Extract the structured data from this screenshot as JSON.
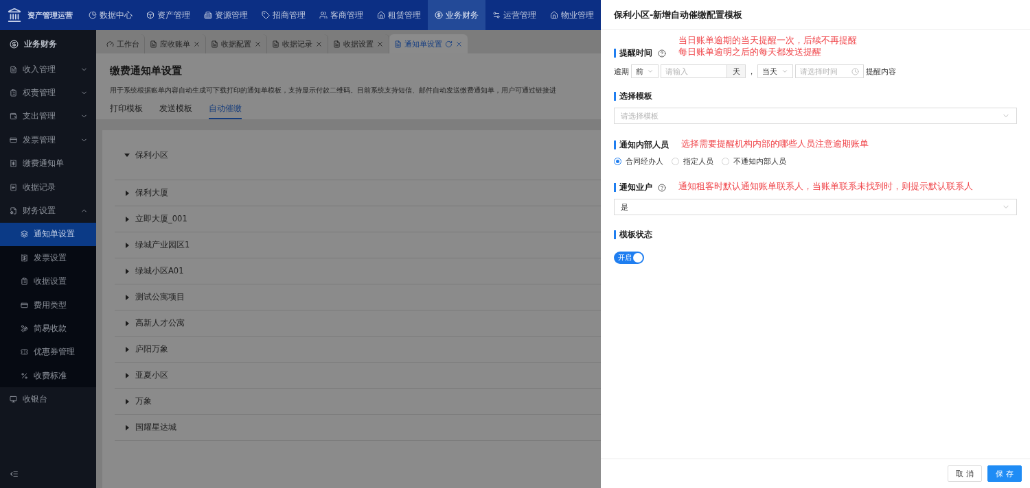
{
  "app": {
    "title": "资产管理运营"
  },
  "top_nav": [
    {
      "label": "数据中心",
      "selected": false
    },
    {
      "label": "资产管理",
      "selected": false
    },
    {
      "label": "资源管理",
      "selected": false
    },
    {
      "label": "招商管理",
      "selected": false
    },
    {
      "label": "客商管理",
      "selected": false
    },
    {
      "label": "租赁管理",
      "selected": false
    },
    {
      "label": "业务财务",
      "selected": true
    },
    {
      "label": "运营管理",
      "selected": false
    },
    {
      "label": "物业管理",
      "selected": false
    }
  ],
  "sidebar": {
    "header": "业务财务",
    "items": [
      {
        "label": "收入管理",
        "kind": "group",
        "expanded": false,
        "selected": false
      },
      {
        "label": "权责管理",
        "kind": "group",
        "expanded": false,
        "selected": false
      },
      {
        "label": "支出管理",
        "kind": "group",
        "expanded": false,
        "selected": false
      },
      {
        "label": "发票管理",
        "kind": "group",
        "expanded": false,
        "selected": false
      },
      {
        "label": "缴费通知单",
        "kind": "link",
        "selected": false
      },
      {
        "label": "收据记录",
        "kind": "link",
        "selected": false
      },
      {
        "label": "财务设置",
        "kind": "group",
        "expanded": true,
        "selected": false,
        "children": [
          {
            "label": "通知单设置",
            "selected": true
          },
          {
            "label": "发票设置",
            "selected": false
          },
          {
            "label": "收据设置",
            "selected": false
          },
          {
            "label": "费用类型",
            "selected": false
          },
          {
            "label": "简易收款",
            "selected": false
          },
          {
            "label": "优惠券管理",
            "selected": false
          },
          {
            "label": "收费标准",
            "selected": false
          }
        ]
      },
      {
        "label": "收银台",
        "kind": "link",
        "selected": false
      }
    ]
  },
  "tabs": [
    {
      "label": "工作台",
      "selected": false,
      "closable": false
    },
    {
      "label": "应收账单",
      "selected": false,
      "closable": true
    },
    {
      "label": "收据配置",
      "selected": false,
      "closable": true
    },
    {
      "label": "收据记录",
      "selected": false,
      "closable": true
    },
    {
      "label": "收据设置",
      "selected": false,
      "closable": true
    },
    {
      "label": "通知单设置",
      "selected": true,
      "closable": true
    }
  ],
  "page": {
    "title": "缴费通知单设置",
    "description": "用于系统根据账单内容自动生成可下载打印的通知单模板，支持显示付款二维码。目前系统支持短信、邮件自动发送缴费通知单，用户可通过链接进",
    "subtabs": [
      {
        "label": "打印模板",
        "selected": false
      },
      {
        "label": "发送模板",
        "selected": false
      },
      {
        "label": "自动催缴",
        "selected": true
      }
    ],
    "tree": [
      {
        "label": "保利小区",
        "expanded": true
      },
      {
        "label": "保利大厦",
        "expanded": false
      },
      {
        "label": "立即大厦_001",
        "expanded": false
      },
      {
        "label": "绿城产业园区1",
        "expanded": false
      },
      {
        "label": "绿城小区A01",
        "expanded": false
      },
      {
        "label": "测试公寓项目",
        "expanded": false
      },
      {
        "label": "高新人才公寓",
        "expanded": false
      },
      {
        "label": "庐阳万象",
        "expanded": false
      },
      {
        "label": "亚夏小区",
        "expanded": false
      },
      {
        "label": "万象",
        "expanded": false
      },
      {
        "label": "国耀星达城",
        "expanded": false
      }
    ]
  },
  "drawer": {
    "title": "保利小区-新增自动催缴配置模板",
    "reminder": {
      "label": "提醒时间",
      "help": true,
      "notes": [
        "当日账单逾期的当天提醒一次，后续不再提醒",
        "每日账单逾明之后的每天都发送提醒"
      ],
      "prefix": "逾期",
      "direction": "前",
      "days_placeholder": "请输入",
      "days_unit": "天",
      "separator": "，",
      "day": "当天",
      "time_placeholder": "请选择时间",
      "suffix": "提醒内容"
    },
    "template": {
      "label": "选择模板",
      "placeholder": "请选择模板"
    },
    "internal": {
      "label": "通知内部人员",
      "note": "选择需要提醒机构内部的哪些人员注意逾期账单",
      "options": [
        {
          "label": "合同经办人",
          "selected": true
        },
        {
          "label": "指定人员",
          "selected": false
        },
        {
          "label": "不通知内部人员",
          "selected": false
        }
      ]
    },
    "owner": {
      "label": "通知业户",
      "help": true,
      "note": "通知租客时默认通知账单联系人，当账单联系未找到时，则提示默认联系人",
      "value": "是"
    },
    "status": {
      "label": "模板状态",
      "on": true,
      "text": "开启"
    },
    "buttons": [
      {
        "label": "取 消",
        "kind": "secondary"
      },
      {
        "label": "保 存",
        "kind": "primary"
      }
    ]
  }
}
